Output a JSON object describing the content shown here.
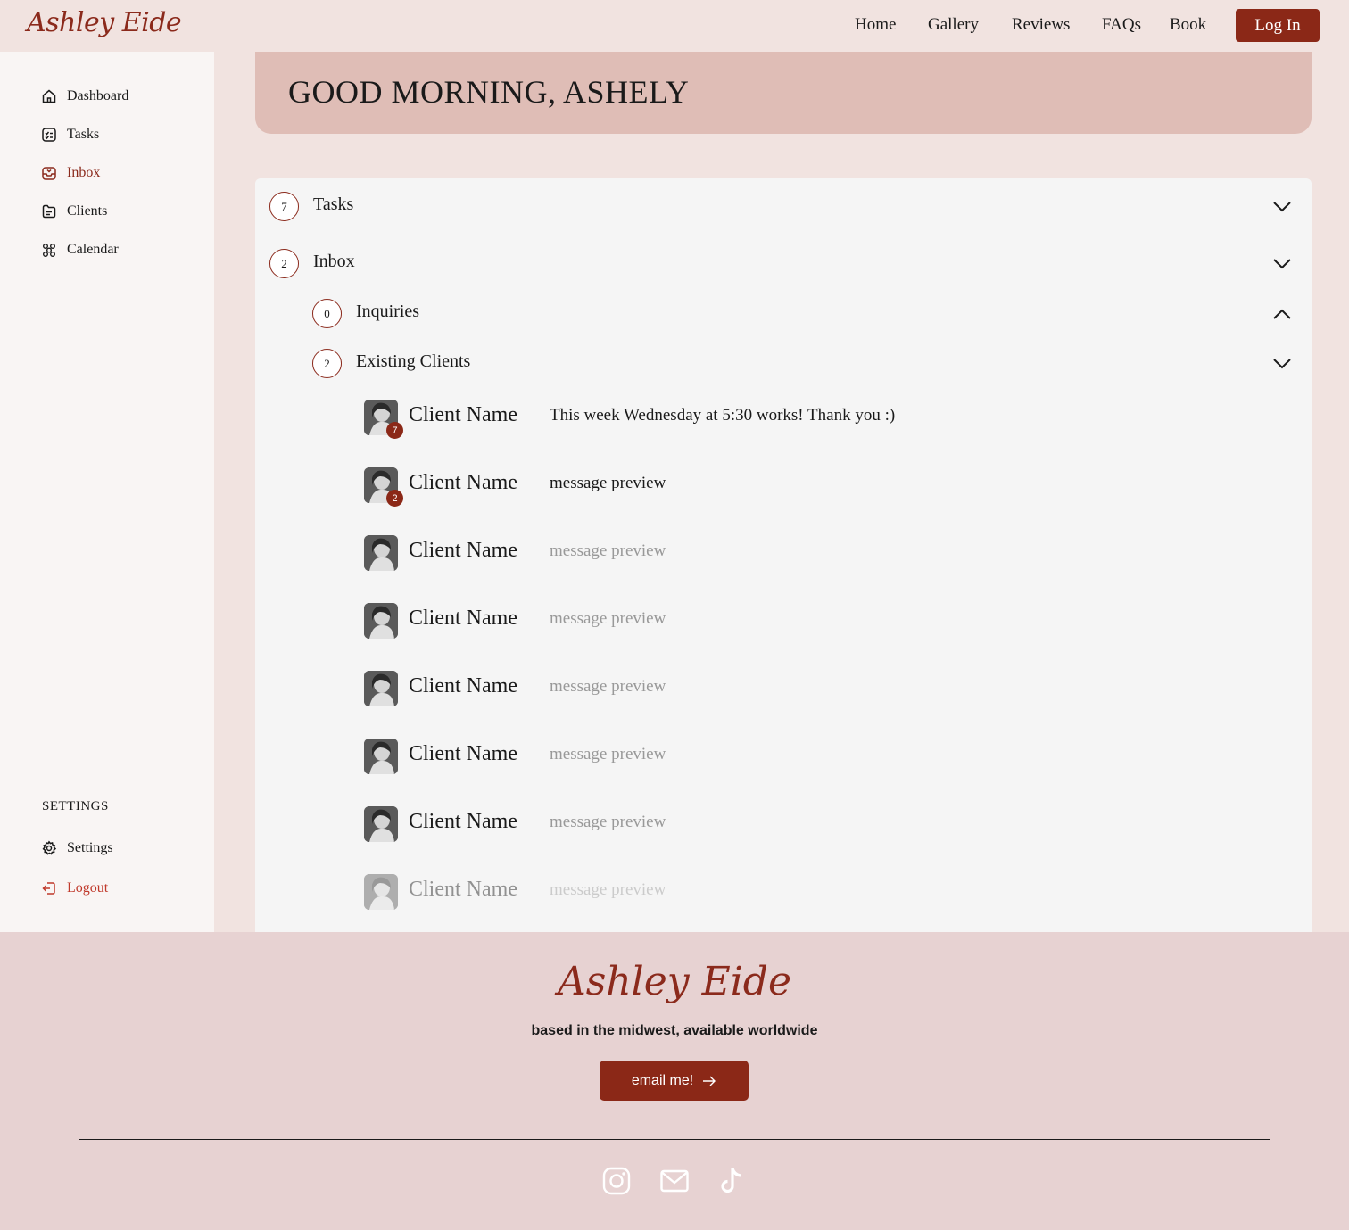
{
  "header": {
    "logo": "Ashley Eide",
    "nav": [
      "Home",
      "Gallery",
      "Reviews",
      "FAQs",
      "Book"
    ],
    "login_label": "Log In"
  },
  "sidebar": {
    "items": [
      {
        "label": "Dashboard",
        "icon": "home-icon"
      },
      {
        "label": "Tasks",
        "icon": "tasks-icon"
      },
      {
        "label": "Inbox",
        "icon": "inbox-icon",
        "active": true
      },
      {
        "label": "Clients",
        "icon": "folder-icon"
      },
      {
        "label": "Calendar",
        "icon": "calendar-icon"
      }
    ],
    "settings_heading": "SETTINGS",
    "settings_label": "Settings",
    "logout_label": "Logout"
  },
  "greeting": "GOOD MORNING, ASHELY",
  "sections": {
    "tasks": {
      "count": "7",
      "label": "Tasks"
    },
    "inbox": {
      "count": "2",
      "label": "Inbox"
    },
    "inquiries": {
      "count": "0",
      "label": "Inquiries"
    },
    "existing": {
      "count": "2",
      "label": "Existing Clients"
    }
  },
  "messages": [
    {
      "name": "Client Name",
      "preview": "This week Wednesday at 5:30 works! Thank you :)",
      "unread": "7"
    },
    {
      "name": "Client Name",
      "preview": "message preview",
      "unread": "2"
    },
    {
      "name": "Client Name",
      "preview": "message preview"
    },
    {
      "name": "Client Name",
      "preview": "message preview"
    },
    {
      "name": "Client Name",
      "preview": "message preview"
    },
    {
      "name": "Client Name",
      "preview": "message preview"
    },
    {
      "name": "Client Name",
      "preview": "message preview"
    },
    {
      "name": "Client Name",
      "preview": "message preview"
    }
  ],
  "footer": {
    "logo": "Ashley Eide",
    "tagline": "based in the midwest, available worldwide",
    "email_label": "email me!",
    "social": [
      "instagram-icon",
      "mail-icon",
      "tiktok-icon"
    ]
  },
  "colors": {
    "accent": "#8b2817",
    "greeting_bg": "#dfbdb6",
    "footer_bg": "#e7d2d2"
  }
}
